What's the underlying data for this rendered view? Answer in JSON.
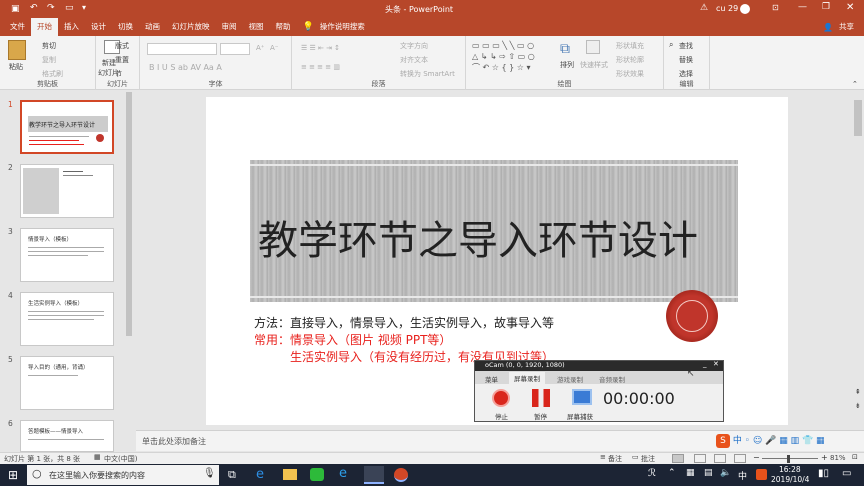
{
  "window": {
    "title": "头条  -  PowerPoint",
    "user": "cu 29"
  },
  "tabs": [
    {
      "label": "文件"
    },
    {
      "label": "开始"
    },
    {
      "label": "插入"
    },
    {
      "label": "设计"
    },
    {
      "label": "切换"
    },
    {
      "label": "动画"
    },
    {
      "label": "幻灯片放映"
    },
    {
      "label": "审阅"
    },
    {
      "label": "视图"
    },
    {
      "label": "帮助"
    }
  ],
  "tell_me": "操作说明搜索",
  "share": "共享",
  "ribbon": {
    "clipboard": {
      "label": "剪贴板",
      "paste": "粘贴",
      "cut": "剪切",
      "copy": "复制",
      "format_painter": "格式刷"
    },
    "slides": {
      "label": "幻灯片",
      "new_slide": "新建",
      "new_slide2": "幻灯片",
      "layout": "版式",
      "reset": "重置",
      "section": "节"
    },
    "font": {
      "label": "字体"
    },
    "paragraph": {
      "label": "段落",
      "text_dir": "文字方向",
      "align_text": "对齐文本",
      "smartart": "转换为 SmartArt"
    },
    "drawing": {
      "label": "绘图",
      "arrange": "排列",
      "quick_styles": "快速样式",
      "fill": "形状填充",
      "outline": "形状轮廓",
      "effects": "形状效果"
    },
    "editing": {
      "label": "编辑",
      "find": "查找",
      "replace": "替换",
      "select": "选择"
    }
  },
  "thumbnails": [
    {
      "num": "1",
      "title": "教学环节之导入环节设计"
    },
    {
      "num": "2",
      "title": ""
    },
    {
      "num": "3",
      "title": "情景导入（模板）"
    },
    {
      "num": "4",
      "title": "生活实例导入（模板）"
    },
    {
      "num": "5",
      "title": "导入目的（通用，背诵）"
    },
    {
      "num": "6",
      "title": "答题模板——情景导入"
    }
  ],
  "slide": {
    "title": "教学环节之导入环节设计",
    "line1": "方法：直接导入，情景导入，生活实例导入，故事导入等",
    "line2": "常用：情景导入（图片 视频 PPT等）",
    "line3": "生活实例导入（有没有经历过，有没有见到过等）"
  },
  "notes_placeholder": "单击此处添加备注",
  "status": {
    "slide_info": "幻灯片 第 1 张，共 8 张",
    "language": "中文(中国)",
    "notes": "备注",
    "comments": "批注",
    "zoom": "81%"
  },
  "ocam": {
    "title": "oCam (0, 0, 1920, 1080)",
    "tabs": [
      "菜单",
      "屏幕录制",
      "游戏录制",
      "音频录制"
    ],
    "stop": "停止",
    "pause": "暂停",
    "capture": "屏幕捕获",
    "timer": "00:00:00"
  },
  "taskbar": {
    "search_placeholder": "在这里输入你要搜索的内容",
    "time": "16:28",
    "date": "2019/10/4",
    "ime": "中"
  },
  "colors": {
    "accent": "#b7472a",
    "red_text": "#e8211d",
    "seal": "#c0352b"
  }
}
